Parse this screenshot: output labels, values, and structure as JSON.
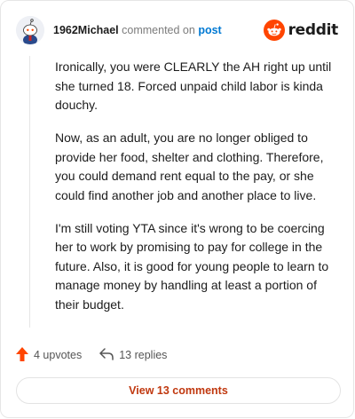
{
  "header": {
    "username": "1962Michael",
    "action_text": "commented on",
    "post_link": "post",
    "brand": "reddit"
  },
  "comment": {
    "paragraphs": [
      "Ironically, you were CLEARLY the AH right up until she turned 18. Forced unpaid child labor is kinda douchy.",
      "Now, as an adult, you are no longer obliged to provide her food, shelter and clothing. Therefore, you could demand rent equal to the pay, or she could find another job and another place to live.",
      "I'm still voting YTA since it's wrong to be coercing her to work by promising to pay for college in the future. Also, it is good for young people to learn to manage money by handling at least a portion of their budget."
    ]
  },
  "actions": {
    "upvotes": "4 upvotes",
    "replies": "13 replies"
  },
  "footer": {
    "view_comments": "View 13 comments"
  },
  "colors": {
    "accent": "#ff4500",
    "link": "#0079d3",
    "button_text": "#c0380f"
  },
  "icons": [
    "avatar",
    "reddit-logo-icon",
    "upvote-arrow-icon",
    "reply-arrow-icon"
  ]
}
